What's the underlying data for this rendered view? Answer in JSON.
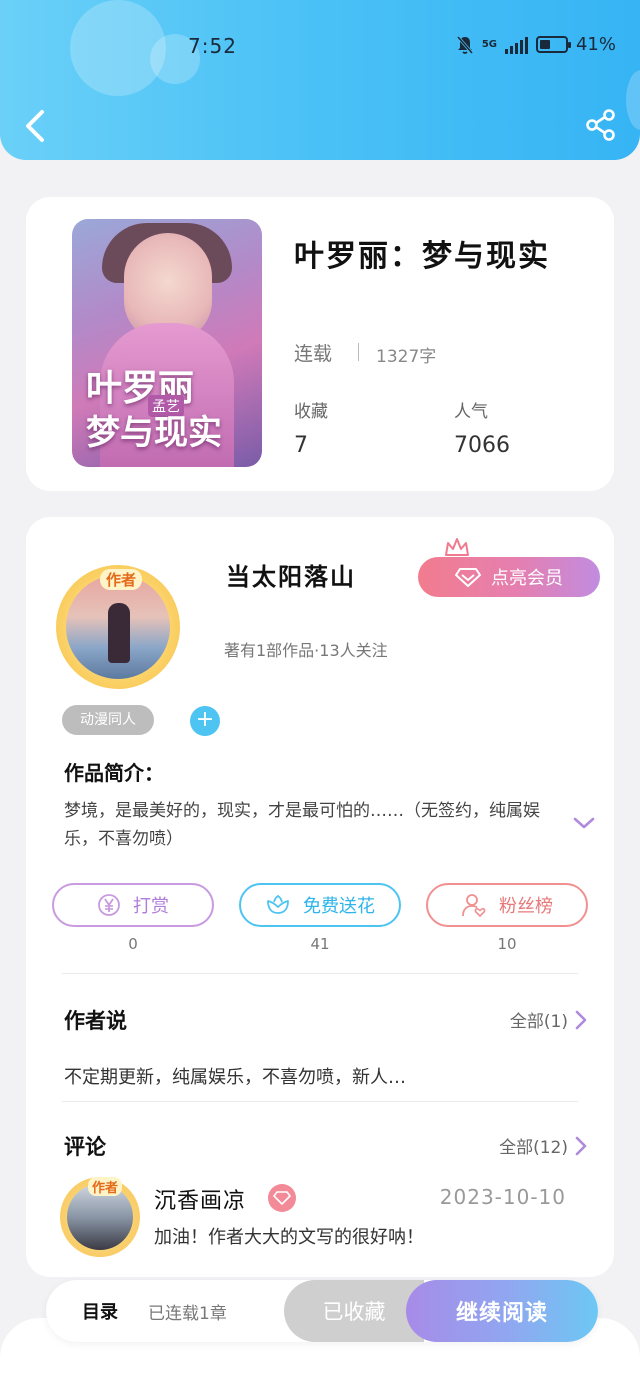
{
  "status": {
    "time": "7:52",
    "network": "5G",
    "battery": "41%",
    "battery_fraction": 0.41
  },
  "book": {
    "title": "叶罗丽：梦与现实",
    "status": "连载",
    "words": "1327字",
    "fav_label": "收藏",
    "fav_count": "7",
    "pop_label": "人气",
    "pop_count": "7066",
    "cover": {
      "line1": "叶罗丽",
      "line2": "梦与现实",
      "author": "孟艺"
    }
  },
  "author": {
    "name": "当太阳落山",
    "badge": "作者",
    "meta": "著有1部作品·13人关注",
    "vip_label": "点亮会员"
  },
  "tags": [
    "动漫同人"
  ],
  "intro": {
    "title": "作品简介：",
    "text": "梦境，是最美好的，现实，才是最可怕的……（无签约，纯属娱乐，不喜勿喷）"
  },
  "actions": [
    {
      "label": "打赏",
      "count": "0",
      "icon": "yen-icon",
      "color": "#c89ae0"
    },
    {
      "label": "免费送花",
      "count": "41",
      "icon": "flower-icon",
      "color": "#4ec4f2"
    },
    {
      "label": "粉丝榜",
      "count": "10",
      "icon": "person-heart-icon",
      "color": "#f09090"
    }
  ],
  "author_says": {
    "title": "作者说",
    "more": "全部(1)",
    "text": "不定期更新，纯属娱乐，不喜勿喷，新人…"
  },
  "comments": {
    "title": "评论",
    "more": "全部(12)",
    "items": [
      {
        "name": "沉香画凉",
        "badge": "作者",
        "date": "2023-10-10",
        "text": "加油！作者大大的文写的很好呐！"
      }
    ]
  },
  "bottom": {
    "toc": "目录",
    "toc_meta": "已连载1章",
    "collected": "已收藏",
    "continue": "继续阅读"
  }
}
